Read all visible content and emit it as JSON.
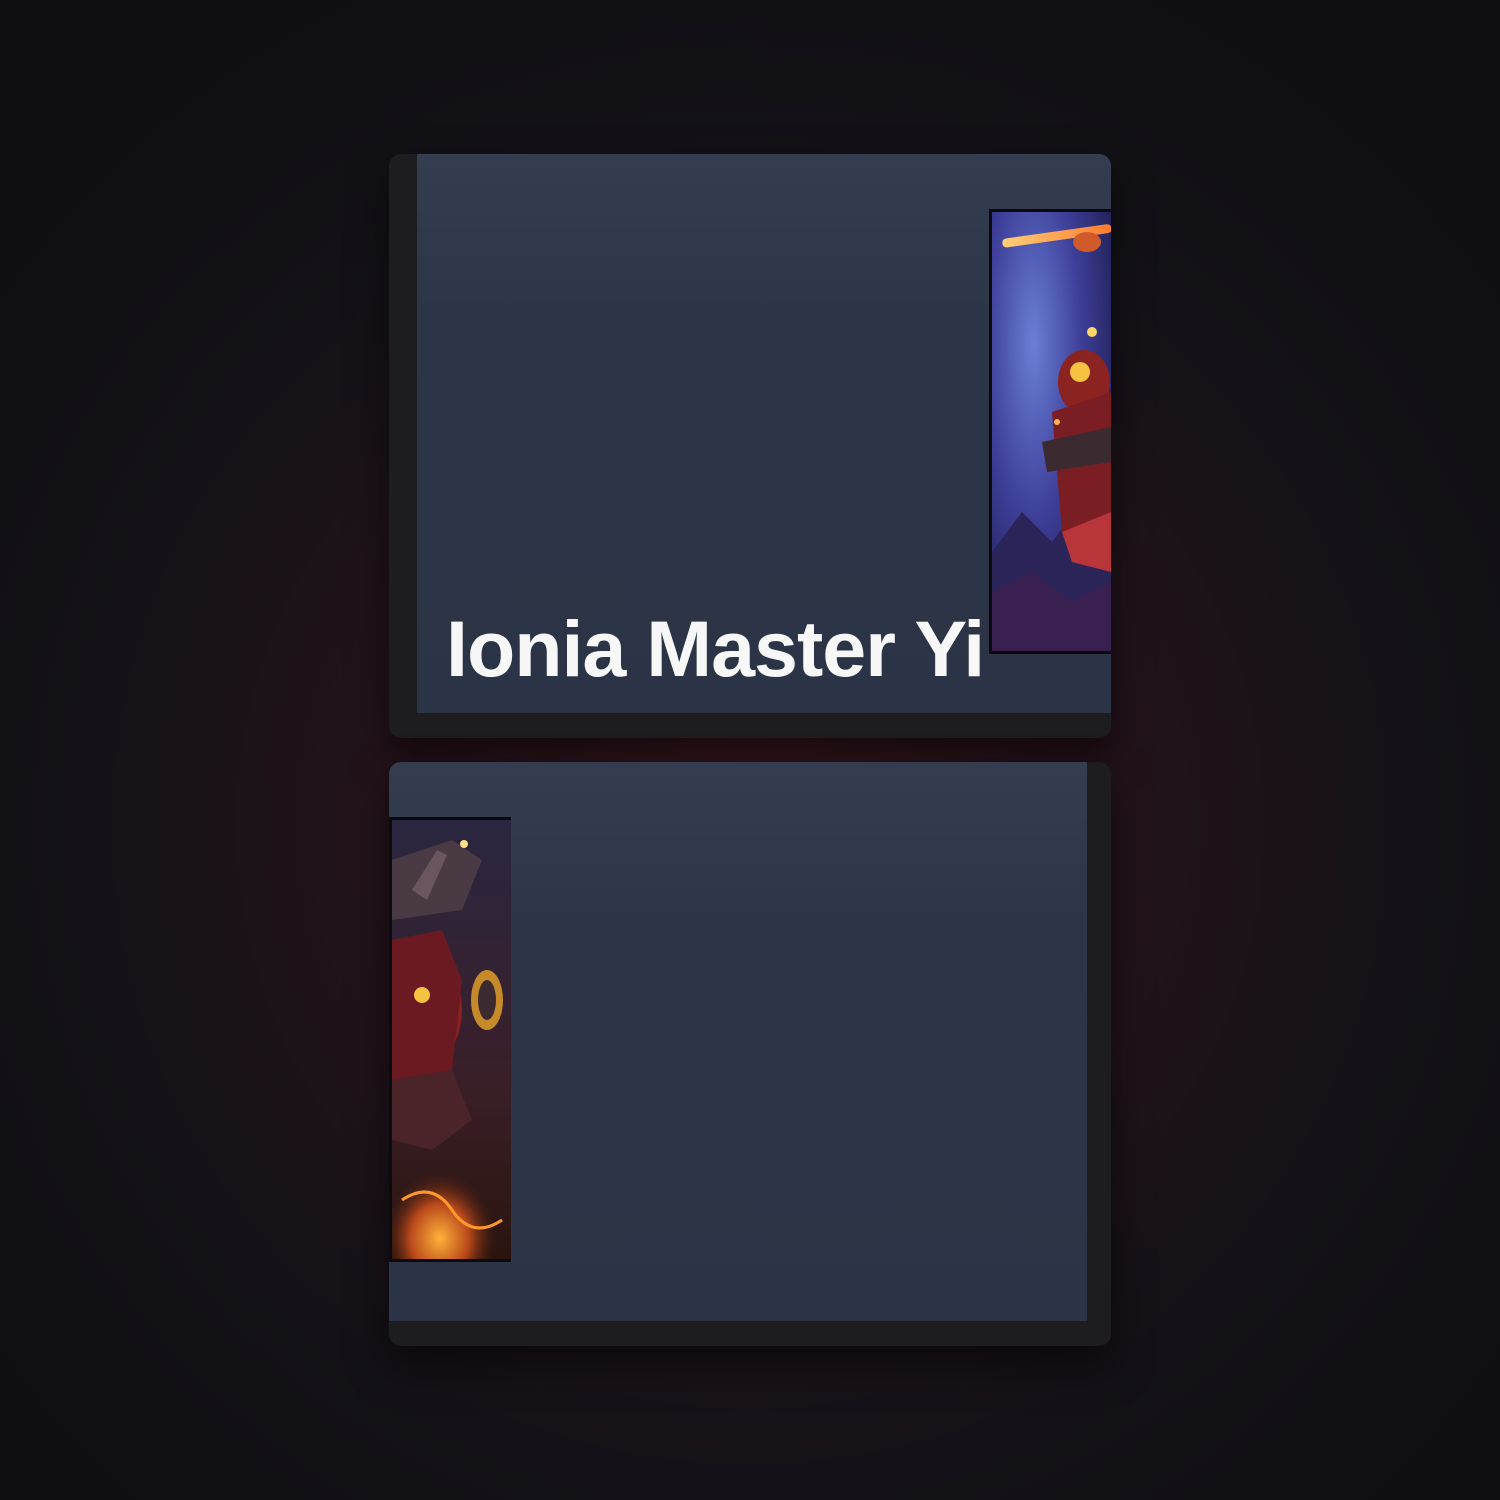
{
  "card": {
    "title": "Ionia Master Yi"
  },
  "colors": {
    "panel": "#2d3548",
    "tile_border": "#1d1d20",
    "title_text": "#f7f7f7",
    "background_glow": "#3a1820"
  },
  "artwork": {
    "subject": "splash-art-warrior"
  }
}
